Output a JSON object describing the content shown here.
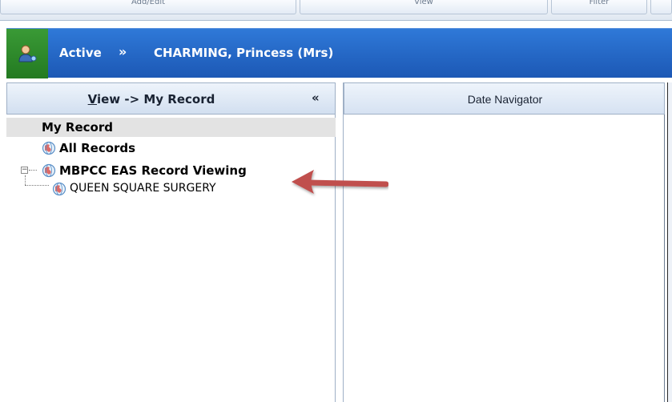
{
  "ribbon": {
    "tabs": [
      "Add/Edit",
      "View",
      "Filter"
    ]
  },
  "banner": {
    "status": "Active",
    "expand_icon": "double-chevron-down-icon",
    "patient_name": "CHARMING, Princess (Mrs)",
    "colors": {
      "banner": "#1f5fbf",
      "status": "#2e8a2b"
    }
  },
  "left_pane": {
    "title_prefix": "V",
    "title_rest": "iew -> My Record",
    "collapse_icon": "double-chevron-left-icon",
    "tree": {
      "my_record": "My Record",
      "all_records": "All Records",
      "group": "MBPCC EAS Record Viewing",
      "child": "QUEEN SQUARE SURGERY"
    }
  },
  "right_pane": {
    "title": "Date Navigator"
  },
  "annotation": {
    "arrow_color": "#c0504d"
  }
}
